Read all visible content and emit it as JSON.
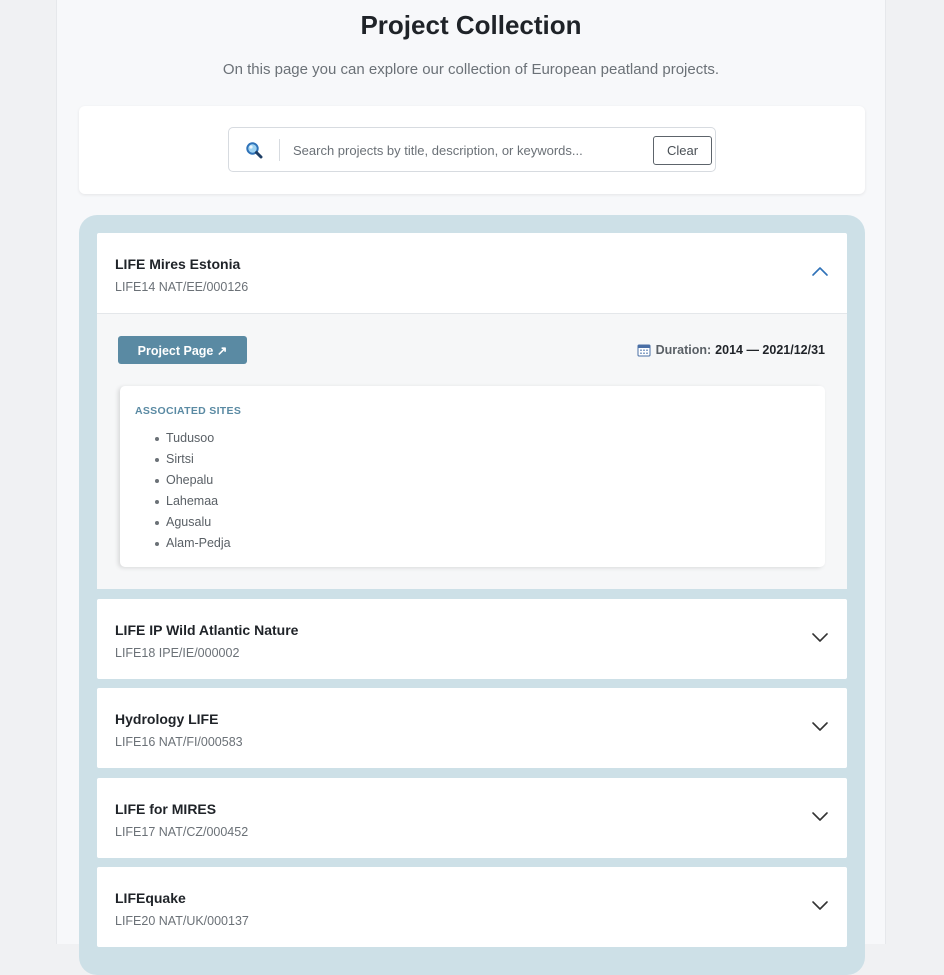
{
  "header": {
    "title": "Project Collection",
    "subtitle": "On this page you can explore our collection of European peatland projects."
  },
  "search": {
    "icon": "search-icon",
    "placeholder": "Search projects by title, description, or keywords...",
    "value": "",
    "clear_label": "Clear"
  },
  "colors": {
    "accent": "#5a8aa3",
    "panel_bg": "#cde0e7"
  },
  "projects": [
    {
      "title": "LIFE Mires Estonia",
      "code": "LIFE14 NAT/EE/000126",
      "expanded": true,
      "project_page_label": "Project Page ↗",
      "duration_label": "Duration:",
      "duration_value": "2014 — 2021/12/31",
      "sites_heading": "ASSOCIATED SITES",
      "sites": [
        "Tudusoo",
        "Sirtsi",
        "Ohepalu",
        "Lahemaa",
        "Agusalu",
        "Alam-Pedja"
      ]
    },
    {
      "title": "LIFE IP Wild Atlantic Nature",
      "code": "LIFE18 IPE/IE/000002",
      "expanded": false
    },
    {
      "title": "Hydrology LIFE",
      "code": "LIFE16 NAT/FI/000583",
      "expanded": false
    },
    {
      "title": "LIFE for MIRES",
      "code": "LIFE17 NAT/CZ/000452",
      "expanded": false
    },
    {
      "title": "LIFEquake",
      "code": "LIFE20 NAT/UK/000137",
      "expanded": false
    }
  ]
}
